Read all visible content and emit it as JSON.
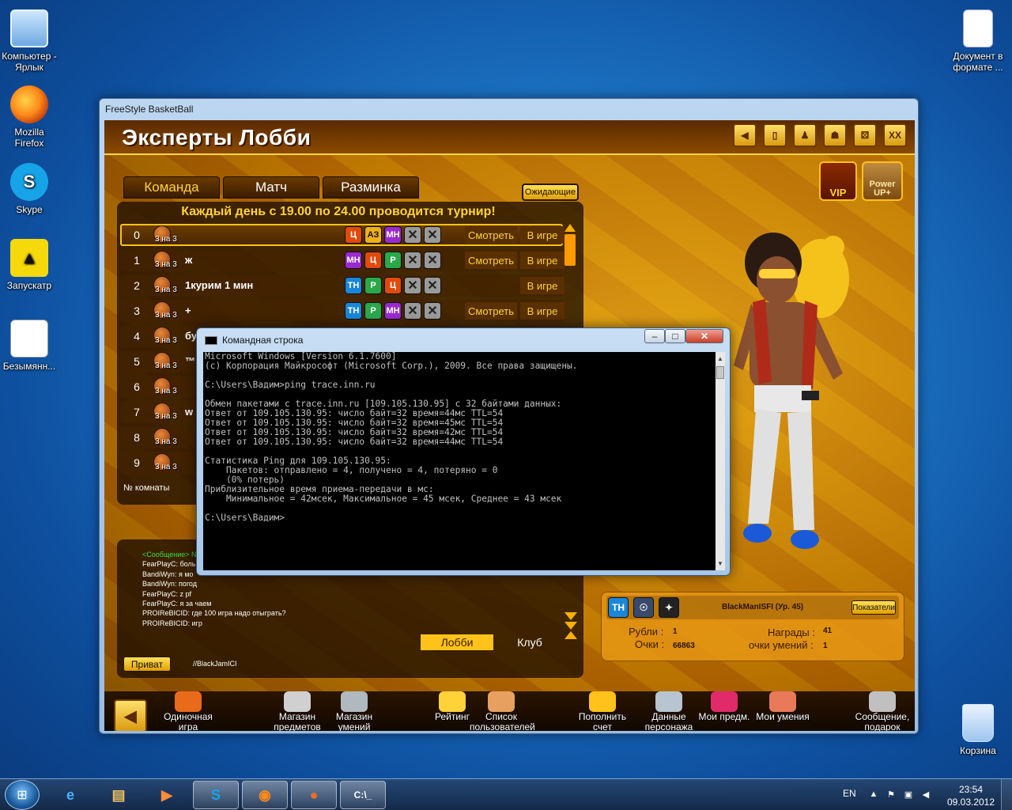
{
  "desktop": {
    "icons": [
      {
        "label": "Компьютер - Ярлык",
        "icon": "computer-icon"
      },
      {
        "label": "Mozilla Firefox",
        "icon": "firefox-icon"
      },
      {
        "label": "Skype",
        "icon": "skype-icon"
      },
      {
        "label": "Запускатр",
        "icon": "launcher-icon"
      },
      {
        "label": "Безымянн...",
        "icon": "paint-file-icon"
      }
    ],
    "doc_icon_label": "Документ в формате ...",
    "recycle_bin_label": "Корзина"
  },
  "game": {
    "window_title": "FreeStyle BasketBall",
    "lobby_title": "Эксперты Лобби",
    "tabs": [
      "Команда",
      "Матч",
      "Разминка"
    ],
    "waiting_label": "Ожидающие",
    "tournament_notice": "Каждый день с 19.00 по 24.00 проводится турнир!",
    "room_mode": "3 на 3",
    "rooms": [
      {
        "num": "0",
        "name": "",
        "watch": "Смотреть",
        "status": "В игре"
      },
      {
        "num": "1",
        "name": "ж",
        "watch": "Смотреть",
        "status": "В игре"
      },
      {
        "num": "2",
        "name": "1курим 1 мин",
        "watch": "",
        "status": "В игре"
      },
      {
        "num": "3",
        "name": "+",
        "watch": "Смотреть",
        "status": "В игре"
      },
      {
        "num": "4",
        "name": "бу",
        "watch": "",
        "status": ""
      },
      {
        "num": "5",
        "name": "™",
        "watch": "",
        "status": ""
      },
      {
        "num": "6",
        "name": "",
        "watch": "",
        "status": ""
      },
      {
        "num": "7",
        "name": "w",
        "watch": "",
        "status": ""
      },
      {
        "num": "8",
        "name": "",
        "watch": "",
        "status": ""
      },
      {
        "num": "9",
        "name": "",
        "watch": "",
        "status": ""
      }
    ],
    "room_badges": [
      [
        "Ц",
        "АЗ",
        "МН",
        "✕",
        "✕"
      ],
      [
        "МН",
        "Ц",
        "Р",
        "✕",
        "✕"
      ],
      [
        "ТН",
        "Р",
        "Ц",
        "✕",
        "✕"
      ],
      [
        "ТН",
        "Р",
        "МН",
        "✕",
        "✕"
      ]
    ],
    "room_number_label": "№ комнаты",
    "chat": {
      "lines": [
        {
          "text": "<Сообщение> N",
          "system": true
        },
        {
          "text": "FearPlayC: боль",
          "system": false
        },
        {
          "text": "BandiWyn: я мо",
          "system": false
        },
        {
          "text": "BandiWyn: погод",
          "system": false
        },
        {
          "text": "FearPlayC: z pf",
          "system": false
        },
        {
          "text": "FearPlayC: я за чаем",
          "system": false
        },
        {
          "text": "PROIReBICID: где 100 игра надо отыграть?",
          "system": false
        },
        {
          "text": "PROIReBICID: игр",
          "system": false
        }
      ],
      "tabs": [
        "Лобби",
        "Клуб"
      ],
      "private_label": "Приват",
      "private_target": "//BlackJamICI"
    },
    "vip_label": "VIP",
    "power_label": "Power UP+",
    "player": {
      "name": "BlackManISFI (Ур. 45)",
      "class_badge": "ТН",
      "stats_button": "Показатели",
      "rubles_label": "Рубли :",
      "rubles_value": "1",
      "points_label": "Очки :",
      "points_value": "66863",
      "awards_label": "Награды :",
      "awards_value": "41",
      "skill_points_label": "очки умений :",
      "skill_points_value": "1"
    },
    "bottom_nav": [
      {
        "label": "Одиночная игра",
        "icon": "solo-game-icon"
      },
      {
        "label": "Магазин предметов",
        "icon": "item-shop-icon"
      },
      {
        "label": "Магазин умений",
        "icon": "skill-shop-icon"
      },
      {
        "label": "Рейтинг",
        "icon": "rating-icon"
      },
      {
        "label": "Список пользователей",
        "icon": "user-list-icon"
      },
      {
        "label": "Пополнить счет",
        "icon": "top-up-icon"
      },
      {
        "label": "Данные персонажа",
        "icon": "character-data-icon"
      },
      {
        "label": "Мои предм.",
        "icon": "my-items-icon"
      },
      {
        "label": "Мои умения",
        "icon": "my-skills-icon"
      },
      {
        "label": "Сообщение, подарок",
        "icon": "message-gift-icon"
      }
    ]
  },
  "cmd": {
    "title": "Командная строка",
    "lines": [
      "Microsoft Windows [Version 6.1.7600]",
      "(c) Корпорация Майкрософт (Microsoft Corp.), 2009. Все права защищены.",
      "",
      "C:\\Users\\Вадим>ping trace.inn.ru",
      "",
      "Обмен пакетами с trace.inn.ru [109.105.130.95] с 32 байтами данных:",
      "Ответ от 109.105.130.95: число байт=32 время=44мс TTL=54",
      "Ответ от 109.105.130.95: число байт=32 время=45мс TTL=54",
      "Ответ от 109.105.130.95: число байт=32 время=42мс TTL=54",
      "Ответ от 109.105.130.95: число байт=32 время=44мс TTL=54",
      "",
      "Статистика Ping для 109.105.130.95:",
      "    Пакетов: отправлено = 4, получено = 4, потеряно = 0",
      "    (0% потерь)",
      "Приблизительное время приема-передачи в мс:",
      "    Минимальное = 42мсек, Максимальное = 45 мсек, Среднее = 43 мсек",
      "",
      "C:\\Users\\Вадим>"
    ]
  },
  "taskbar": {
    "lang": "EN",
    "time": "23:54",
    "date": "09.03.2012"
  }
}
